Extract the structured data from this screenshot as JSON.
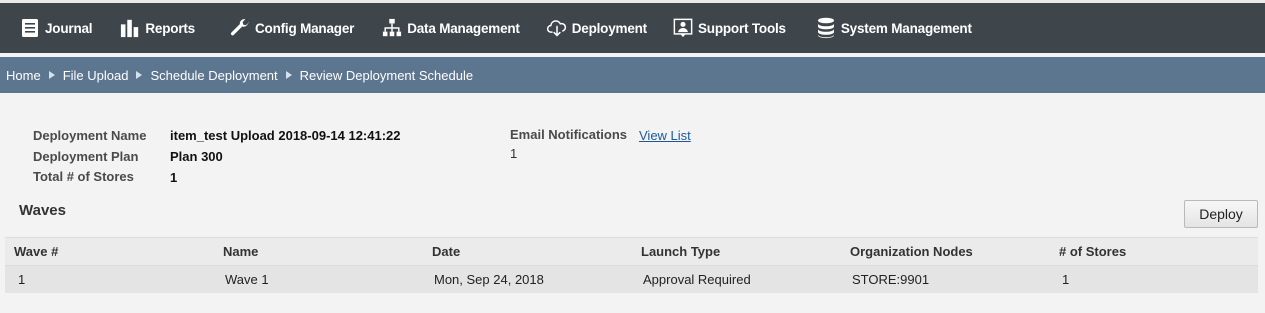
{
  "nav": {
    "items": [
      {
        "label": "Journal",
        "icon": "journal-icon"
      },
      {
        "label": "Reports",
        "icon": "bar-chart-icon"
      },
      {
        "label": "Config Manager",
        "icon": "wrench-icon"
      },
      {
        "label": "Data Management",
        "icon": "hierarchy-icon"
      },
      {
        "label": "Deployment",
        "icon": "cloud-download-icon"
      },
      {
        "label": "Support Tools",
        "icon": "support-person-icon"
      },
      {
        "label": "System Management",
        "icon": "database-icon"
      }
    ]
  },
  "breadcrumb": {
    "items": [
      "Home",
      "File Upload",
      "Schedule Deployment",
      "Review Deployment Schedule"
    ]
  },
  "details": {
    "deployment_name_label": "Deployment Name",
    "deployment_name_value": "item_test Upload 2018-09-14 12:41:22",
    "deployment_plan_label": "Deployment Plan",
    "deployment_plan_value": "Plan 300",
    "total_stores_label": "Total # of Stores",
    "total_stores_value": "1",
    "email_notifications_label": "Email Notifications",
    "email_notifications_link": "View List",
    "email_notifications_count": "1"
  },
  "waves": {
    "title": "Waves",
    "deploy_label": "Deploy",
    "columns": [
      "Wave #",
      "Name",
      "Date",
      "Launch Type",
      "Organization Nodes",
      "# of Stores"
    ],
    "rows": [
      [
        "1",
        "Wave 1",
        "Mon, Sep 24, 2018",
        "Approval Required",
        "STORE:9901",
        "1"
      ]
    ]
  },
  "colors": {
    "nav_bg": "#3e464c",
    "breadcrumb_bg": "#5d768f",
    "link": "#1a5a9c"
  }
}
